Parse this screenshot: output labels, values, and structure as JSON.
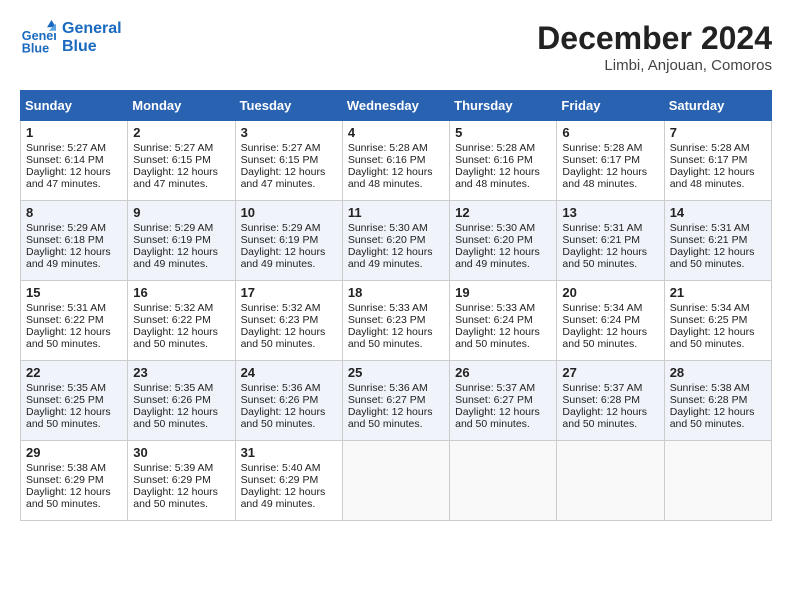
{
  "logo": {
    "line1": "General",
    "line2": "Blue"
  },
  "title": "December 2024",
  "subtitle": "Limbi, Anjouan, Comoros",
  "header": {
    "days": [
      "Sunday",
      "Monday",
      "Tuesday",
      "Wednesday",
      "Thursday",
      "Friday",
      "Saturday"
    ]
  },
  "weeks": [
    [
      {
        "day": "1",
        "sunrise": "5:27 AM",
        "sunset": "6:14 PM",
        "daylight": "12 hours and 47 minutes."
      },
      {
        "day": "2",
        "sunrise": "5:27 AM",
        "sunset": "6:15 PM",
        "daylight": "12 hours and 47 minutes."
      },
      {
        "day": "3",
        "sunrise": "5:27 AM",
        "sunset": "6:15 PM",
        "daylight": "12 hours and 47 minutes."
      },
      {
        "day": "4",
        "sunrise": "5:28 AM",
        "sunset": "6:16 PM",
        "daylight": "12 hours and 48 minutes."
      },
      {
        "day": "5",
        "sunrise": "5:28 AM",
        "sunset": "6:16 PM",
        "daylight": "12 hours and 48 minutes."
      },
      {
        "day": "6",
        "sunrise": "5:28 AM",
        "sunset": "6:17 PM",
        "daylight": "12 hours and 48 minutes."
      },
      {
        "day": "7",
        "sunrise": "5:28 AM",
        "sunset": "6:17 PM",
        "daylight": "12 hours and 48 minutes."
      }
    ],
    [
      {
        "day": "8",
        "sunrise": "5:29 AM",
        "sunset": "6:18 PM",
        "daylight": "12 hours and 49 minutes."
      },
      {
        "day": "9",
        "sunrise": "5:29 AM",
        "sunset": "6:19 PM",
        "daylight": "12 hours and 49 minutes."
      },
      {
        "day": "10",
        "sunrise": "5:29 AM",
        "sunset": "6:19 PM",
        "daylight": "12 hours and 49 minutes."
      },
      {
        "day": "11",
        "sunrise": "5:30 AM",
        "sunset": "6:20 PM",
        "daylight": "12 hours and 49 minutes."
      },
      {
        "day": "12",
        "sunrise": "5:30 AM",
        "sunset": "6:20 PM",
        "daylight": "12 hours and 49 minutes."
      },
      {
        "day": "13",
        "sunrise": "5:31 AM",
        "sunset": "6:21 PM",
        "daylight": "12 hours and 50 minutes."
      },
      {
        "day": "14",
        "sunrise": "5:31 AM",
        "sunset": "6:21 PM",
        "daylight": "12 hours and 50 minutes."
      }
    ],
    [
      {
        "day": "15",
        "sunrise": "5:31 AM",
        "sunset": "6:22 PM",
        "daylight": "12 hours and 50 minutes."
      },
      {
        "day": "16",
        "sunrise": "5:32 AM",
        "sunset": "6:22 PM",
        "daylight": "12 hours and 50 minutes."
      },
      {
        "day": "17",
        "sunrise": "5:32 AM",
        "sunset": "6:23 PM",
        "daylight": "12 hours and 50 minutes."
      },
      {
        "day": "18",
        "sunrise": "5:33 AM",
        "sunset": "6:23 PM",
        "daylight": "12 hours and 50 minutes."
      },
      {
        "day": "19",
        "sunrise": "5:33 AM",
        "sunset": "6:24 PM",
        "daylight": "12 hours and 50 minutes."
      },
      {
        "day": "20",
        "sunrise": "5:34 AM",
        "sunset": "6:24 PM",
        "daylight": "12 hours and 50 minutes."
      },
      {
        "day": "21",
        "sunrise": "5:34 AM",
        "sunset": "6:25 PM",
        "daylight": "12 hours and 50 minutes."
      }
    ],
    [
      {
        "day": "22",
        "sunrise": "5:35 AM",
        "sunset": "6:25 PM",
        "daylight": "12 hours and 50 minutes."
      },
      {
        "day": "23",
        "sunrise": "5:35 AM",
        "sunset": "6:26 PM",
        "daylight": "12 hours and 50 minutes."
      },
      {
        "day": "24",
        "sunrise": "5:36 AM",
        "sunset": "6:26 PM",
        "daylight": "12 hours and 50 minutes."
      },
      {
        "day": "25",
        "sunrise": "5:36 AM",
        "sunset": "6:27 PM",
        "daylight": "12 hours and 50 minutes."
      },
      {
        "day": "26",
        "sunrise": "5:37 AM",
        "sunset": "6:27 PM",
        "daylight": "12 hours and 50 minutes."
      },
      {
        "day": "27",
        "sunrise": "5:37 AM",
        "sunset": "6:28 PM",
        "daylight": "12 hours and 50 minutes."
      },
      {
        "day": "28",
        "sunrise": "5:38 AM",
        "sunset": "6:28 PM",
        "daylight": "12 hours and 50 minutes."
      }
    ],
    [
      {
        "day": "29",
        "sunrise": "5:38 AM",
        "sunset": "6:29 PM",
        "daylight": "12 hours and 50 minutes."
      },
      {
        "day": "30",
        "sunrise": "5:39 AM",
        "sunset": "6:29 PM",
        "daylight": "12 hours and 50 minutes."
      },
      {
        "day": "31",
        "sunrise": "5:40 AM",
        "sunset": "6:29 PM",
        "daylight": "12 hours and 49 minutes."
      },
      null,
      null,
      null,
      null
    ]
  ],
  "labels": {
    "sunrise": "Sunrise:",
    "sunset": "Sunset:",
    "daylight": "Daylight:"
  }
}
